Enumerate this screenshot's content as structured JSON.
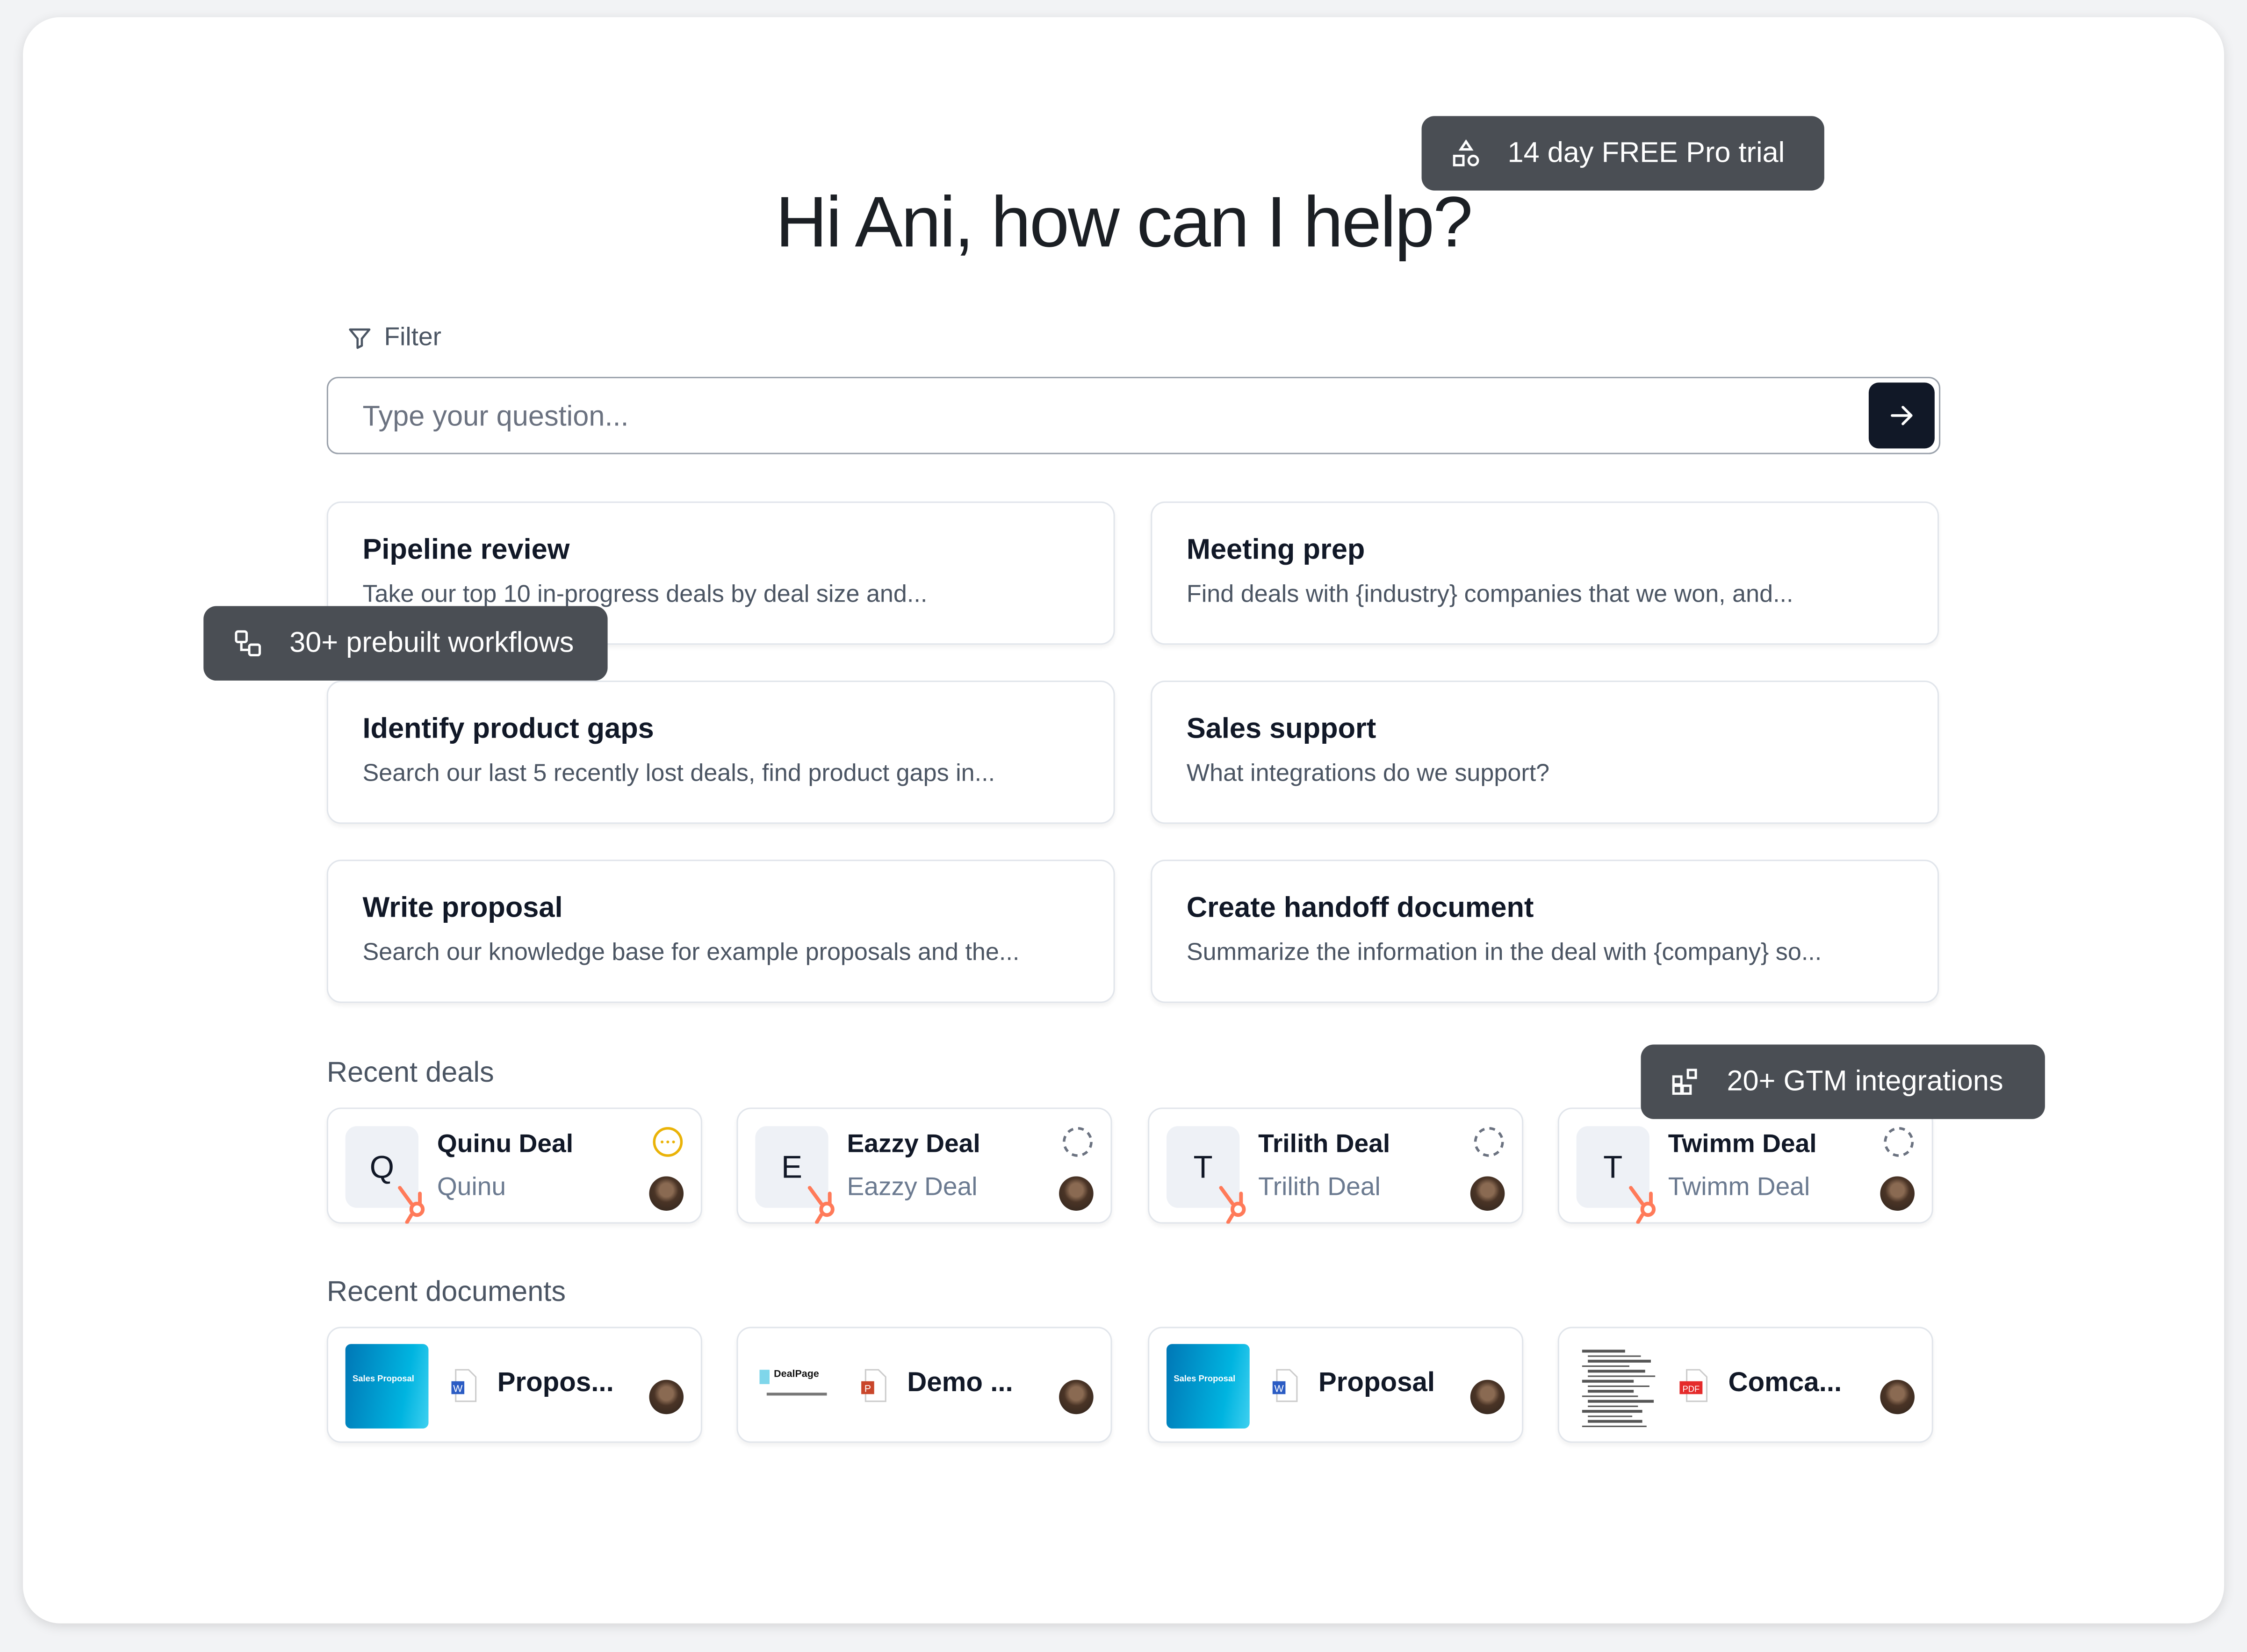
{
  "header": {
    "greeting": "Hi Ani, how can I help?"
  },
  "filter": {
    "label": "Filter",
    "icon": "filter-icon"
  },
  "search": {
    "placeholder": "Type your question...",
    "value": "",
    "submit_icon": "arrow-right-icon"
  },
  "prompts": [
    {
      "title": "Pipeline review",
      "desc": "Take our top 10 in-progress deals by deal size and..."
    },
    {
      "title": "Meeting prep",
      "desc": "Find deals with {industry} companies that we won, and..."
    },
    {
      "title": "Identify product gaps",
      "desc": "Search our last 5 recently lost deals, find product gaps in..."
    },
    {
      "title": "Sales support",
      "desc": "What integrations do we support?"
    },
    {
      "title": "Write proposal",
      "desc": "Search our knowledge base for example proposals and the..."
    },
    {
      "title": "Create handoff document",
      "desc": "Summarize the information in the deal with {company} so..."
    }
  ],
  "recent_deals": {
    "label": "Recent deals",
    "items": [
      {
        "letter": "Q",
        "name": "Quinu Deal",
        "company": "Quinu",
        "status": "in-progress"
      },
      {
        "letter": "E",
        "name": "Eazzy Deal",
        "company": "Eazzy Deal",
        "status": "pending"
      },
      {
        "letter": "T",
        "name": "Trilith Deal",
        "company": "Trilith Deal",
        "status": "pending"
      },
      {
        "letter": "T",
        "name": "Twimm Deal",
        "company": "Twimm Deal",
        "status": "pending"
      }
    ]
  },
  "recent_documents": {
    "label": "Recent documents",
    "items": [
      {
        "name": "Propos...",
        "type": "word",
        "thumb_text": "Sales Proposal"
      },
      {
        "name": "Demo ...",
        "type": "powerpoint",
        "thumb_text": "DealPage"
      },
      {
        "name": "Proposal",
        "type": "word",
        "thumb_text": "Sales Proposal"
      },
      {
        "name": "Comca...",
        "type": "pdf",
        "thumb_text": ""
      }
    ]
  },
  "badges": {
    "trial": "14 day FREE Pro trial",
    "workflows": "30+ prebuilt workflows",
    "integrations": "20+ GTM integrations"
  },
  "colors": {
    "hubspot": "#ff7a59",
    "badge_bg": "#4a4e54",
    "send_bg": "#111827",
    "status_active": "#eab308"
  }
}
